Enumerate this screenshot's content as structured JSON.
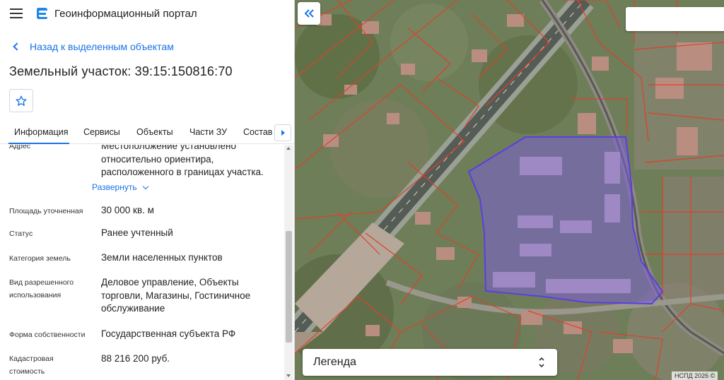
{
  "app": {
    "title": "Геоинформационный портал"
  },
  "nav": {
    "back_label": "Назад к выделенным объектам"
  },
  "object": {
    "title": "Земельный участок: 39:15:150816:70"
  },
  "tabs": [
    {
      "label": "Информация",
      "active": true
    },
    {
      "label": "Сервисы",
      "active": false
    },
    {
      "label": "Объекты",
      "active": false
    },
    {
      "label": "Части ЗУ",
      "active": false
    },
    {
      "label": "Состав",
      "active": false
    }
  ],
  "details": {
    "address": {
      "label": "Адрес",
      "value": "Местоположение установлено относительно ориентира, расположенного в границах участка.",
      "expand_label": "Развернуть"
    },
    "area": {
      "label": "Площадь уточненная",
      "value": "30 000 кв. м"
    },
    "status": {
      "label": "Статус",
      "value": "Ранее учтенный"
    },
    "category": {
      "label": "Категория земель",
      "value": "Земли населенных пунктов"
    },
    "permitted_use": {
      "label": "Вид разрешенного использования",
      "value": "Деловое управление, Объекты торговли, Магазины, Гостиничное обслуживание"
    },
    "ownership": {
      "label": "Форма собственности",
      "value": "Государственная субъекта РФ"
    },
    "cadastral_value": {
      "label": "Кадастровая стоимость",
      "value": "88 216 200 руб."
    }
  },
  "map": {
    "search_value": "",
    "legend_label": "Легенда",
    "attribution": "НСПД 2026 ©",
    "parcel_fill": "#7b5fd6",
    "parcel_stroke": "#5a3fe0",
    "boundary_color": "#e0402a"
  },
  "colors": {
    "accent": "#1a73e8"
  },
  "icons": {
    "menu": "menu-icon",
    "logo": "portal-logo-icon",
    "back": "chevron-left-icon",
    "favorite": "star-icon",
    "tabs_next": "chevron-right-icon",
    "expand": "chevron-down-icon",
    "collapse_panel": "double-chevron-left-icon",
    "legend_toggle": "updown-icon"
  }
}
